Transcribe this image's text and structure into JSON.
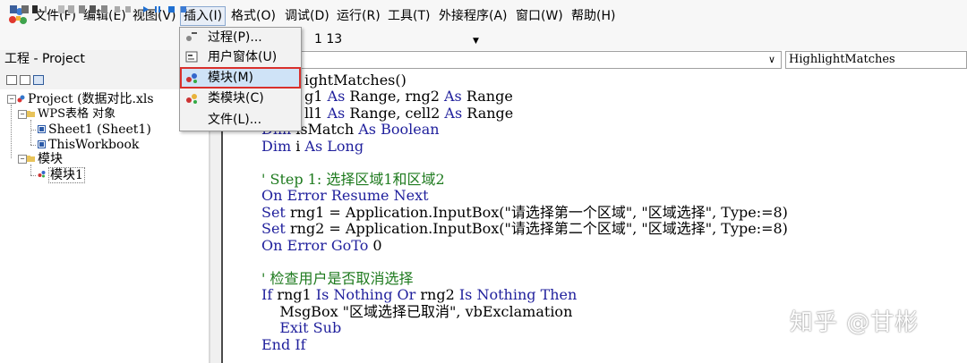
{
  "menubar": {
    "items": [
      "文件(F)",
      "编辑(E)",
      "视图(V)",
      "插入(I)",
      "格式(O)",
      "调试(D)",
      "运行(R)",
      "工具(T)",
      "外接程序(A)",
      "窗口(W)",
      "帮助(H)"
    ]
  },
  "toolbar": {
    "line_indicator": "1 13"
  },
  "project": {
    "title": "工程 - Project",
    "close": "×",
    "tree": {
      "root": "Project (数据对比.xls",
      "folder_objects": "WPS表格 对象",
      "sheet1": "Sheet1 (Sheet1)",
      "thisworkbook": "ThisWorkbook",
      "folder_modules": "模块",
      "module1": "模块1"
    }
  },
  "combos": {
    "procedure": "HighlightMatches",
    "arrow": "∨"
  },
  "insert_menu": {
    "items": [
      "过程(P)...",
      "用户窗体(U)",
      "模块(M)",
      "类模块(C)",
      "文件(L)..."
    ]
  },
  "code": {
    "line1": "ightMatches()",
    "line2_a": "g1 ",
    "line2_b": "As",
    "line2_c": " Range, rng2 ",
    "line2_d": "As",
    "line2_e": " Range",
    "line3_a": "ll1 ",
    "line3_b": "As",
    "line3_c": " Range, cell2 ",
    "line3_d": "As",
    "line3_e": " Range",
    "line4_a": "Dim",
    "line4_b": " isMatch ",
    "line4_c": "As Boolean",
    "line5_a": "Dim",
    "line5_b": " i ",
    "line5_c": "As Long",
    "line6": "' Step 1: 选择区域1和区域2",
    "line7": "On Error Resume Next",
    "line8_a": "Set",
    "line8_b": " rng1 = Application.InputBox(\"请选择第一个区域\", \"区域选择\", Type:=8)",
    "line9_a": "Set",
    "line9_b": " rng2 = Application.InputBox(\"请选择第二个区域\", \"区域选择\", Type:=8)",
    "line10_a": "On Error GoTo",
    "line10_b": " 0",
    "line11": "' 检查用户是否取消选择",
    "line12_a": "If",
    "line12_b": " rng1 ",
    "line12_c": "Is Nothing Or",
    "line12_d": " rng2 ",
    "line12_e": "Is Nothing Then",
    "line13": "    MsgBox \"区域选择已取消\", vbExclamation",
    "line14": "    Exit Sub",
    "line15": "End If"
  },
  "watermark": "知乎 @甘彬",
  "colors": {
    "keyword": "#1f1f9c",
    "comment": "#1e7a1e",
    "menu_highlight_border": "#d9302c"
  }
}
